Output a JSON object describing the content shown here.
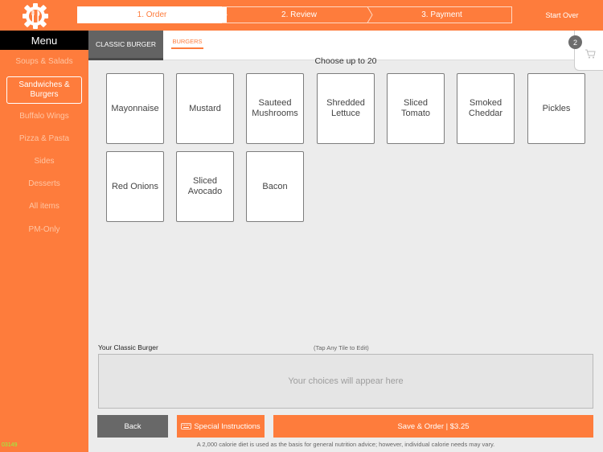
{
  "colors": {
    "accent": "#fe7c3c",
    "sidebar_inactive_text": "#ffc5a3",
    "dark": "#636363"
  },
  "header": {
    "steps": [
      {
        "label": "1. Order",
        "active": true
      },
      {
        "label": "2. Review",
        "active": false
      },
      {
        "label": "3. Payment",
        "active": false
      }
    ],
    "start_over": "Start Over"
  },
  "sidebar": {
    "title": "Menu",
    "items": [
      {
        "label": "Soups & Salads"
      },
      {
        "label": "Sandwiches & Burgers",
        "selected": true
      },
      {
        "label": "Buffalo Wings"
      },
      {
        "label": "Pizza & Pasta"
      },
      {
        "label": "Sides"
      },
      {
        "label": "Desserts"
      },
      {
        "label": "All items"
      },
      {
        "label": "PM-Only"
      }
    ],
    "version": "03149"
  },
  "tabs": {
    "item": "CLASSIC BURGER",
    "category": "BURGERS"
  },
  "cart": {
    "count": "2",
    "icon": "cart-icon"
  },
  "options": {
    "prompt": "Choose up to 20",
    "items": [
      "Mayonnaise",
      "Mustard",
      "Sauteed Mushrooms",
      "Shredded Lettuce",
      "Sliced Tomato",
      "Smoked Cheddar",
      "Pickles",
      "Red Onions",
      "Sliced Avocado",
      "Bacon"
    ]
  },
  "summary": {
    "title": "Your Classic Burger",
    "hint": "(Tap Any Tile to Edit)",
    "placeholder": "Your choices will appear here"
  },
  "actions": {
    "back": "Back",
    "special": "Special Instructions",
    "save": "Save & Order | $3.25"
  },
  "disclaimer": "A 2,000 calorie diet is used as the basis for general nutrition advice; however, individual calorie needs may vary."
}
